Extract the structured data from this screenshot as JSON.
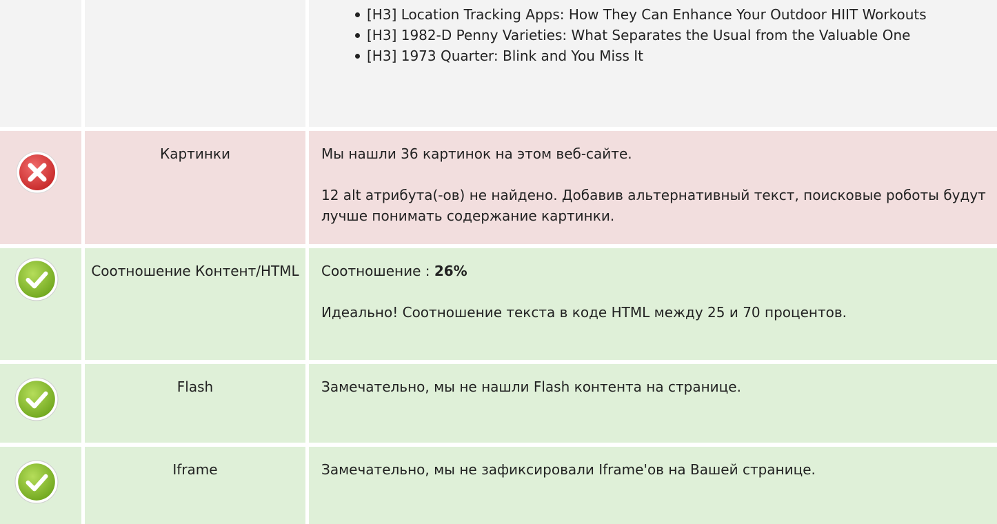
{
  "headings_row": {
    "items": [
      "[H3] Location Tracking Apps: How They Can Enhance Your Outdoor HIIT Workouts",
      "[H3] 1982-D Penny Varieties: What Separates the Usual from the Valuable One",
      "[H3] 1973 Quarter: Blink and You Miss It"
    ]
  },
  "images_row": {
    "status": "error",
    "icon": "error-x-icon",
    "label": "Картинки",
    "line1": "Мы нашли 36 картинок на этом веб-сайте.",
    "line2": "12 alt атрибута(-ов) не найдено. Добавив альтернативный текст, поисковые роботы будут лучше понимать содержание картинки."
  },
  "ratio_row": {
    "status": "ok",
    "icon": "check-icon",
    "label": "Соотношение Контент/HTML",
    "prefix": "Соотношение : ",
    "value": "26%",
    "line2": "Идеально! Соотношение текста в коде HTML между 25 и 70 процентов."
  },
  "flash_row": {
    "status": "ok",
    "icon": "check-icon",
    "label": "Flash",
    "line1": "Замечательно, мы не нашли Flash контента на странице."
  },
  "iframe_row": {
    "status": "ok",
    "icon": "check-icon",
    "label": "Iframe",
    "line1": "Замечательно, мы не зафиксировали Iframe'ов на Вашей странице."
  },
  "colors": {
    "error_bg": "#f2dede",
    "ok_bg": "#dff0d8",
    "neutral_bg": "#f3f3f3",
    "error_icon": "#e23b3b",
    "ok_icon": "#8cc63f"
  }
}
